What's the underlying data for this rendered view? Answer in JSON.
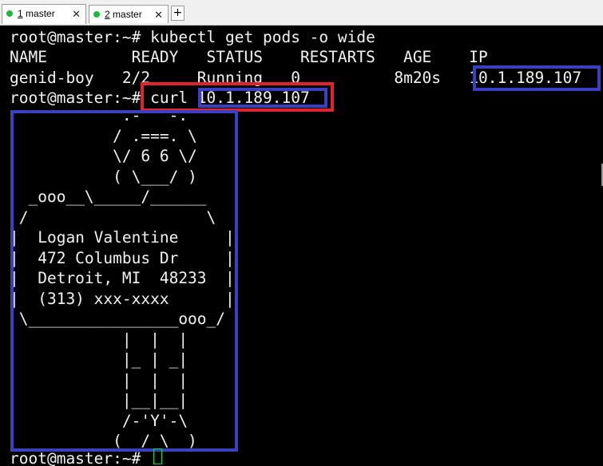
{
  "tabs": [
    {
      "number": "1",
      "name": " master",
      "close": "✕",
      "status_color": "#1fb83c"
    },
    {
      "number": "2",
      "name": " master",
      "close": "✕",
      "status_color": "#1fb83c"
    }
  ],
  "new_tab_label": "+",
  "terminal": {
    "lines": [
      "root@master:~# kubectl get pods -o wide",
      "NAME         READY   STATUS    RESTARTS   AGE    IP",
      "genid-boy   2/2     Running   0          8m20s   10.1.189.107",
      "root@master:~# curl 10.1.189.107",
      "            .-\"\"\"-.",
      "           / .===. \\",
      "           \\/ 6 6 \\/",
      "           ( \\___/ )",
      "  _ooo__\\_____/______",
      " /                   \\",
      "|  Logan Valentine     |",
      "|  472 Columbus Dr     |",
      "|  Detroit, MI  48233  |",
      "|  (313) xxx-xxxx      |",
      " \\________________ooo_/",
      "            |  |  |",
      "            |_ | _|",
      "            |  |  |",
      "            |__|__|",
      "            /-'Y'-\\",
      "           (__/ \\__)",
      "root@master:~# "
    ]
  },
  "colors": {
    "highlight_red": "#e0242d",
    "highlight_blue": "#3b3fc2",
    "cursor": "#15d44a",
    "text": "#f2f2f2",
    "background": "#000000"
  }
}
